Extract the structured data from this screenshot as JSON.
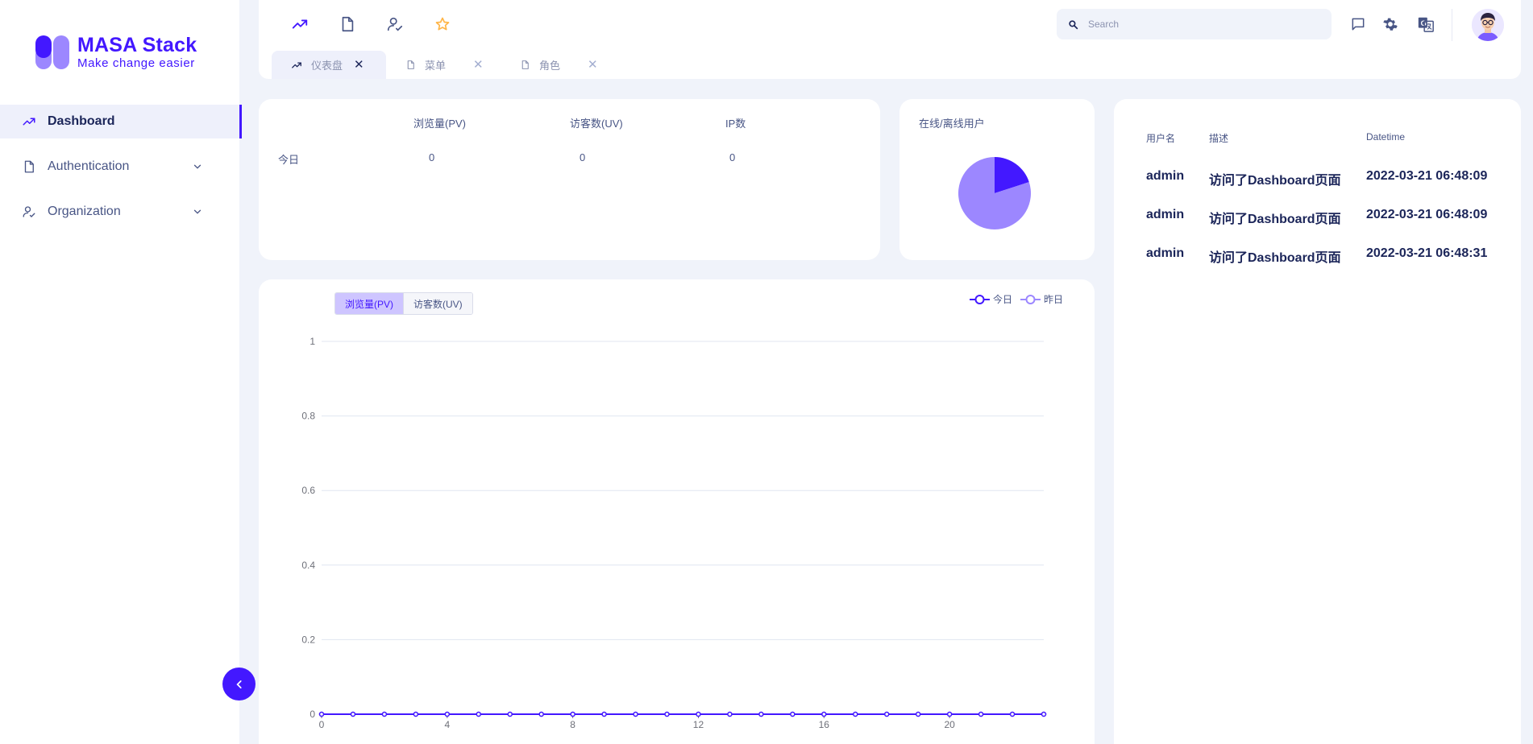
{
  "brand": {
    "title": "MASA Stack",
    "subtitle": "Make change easier",
    "accent": "#4318ff"
  },
  "sidebar": {
    "items": [
      {
        "label": "Dashboard",
        "icon": "trending-up-icon",
        "active": true
      },
      {
        "label": "Authentication",
        "icon": "file-icon",
        "expandable": true
      },
      {
        "label": "Organization",
        "icon": "user-check-icon",
        "expandable": true
      }
    ],
    "collapse_icon": "chevron-left-icon"
  },
  "header": {
    "quick_icons": [
      "trending-up-icon",
      "file-icon",
      "user-check-icon",
      "star-icon"
    ],
    "search": {
      "placeholder": "Search",
      "value": ""
    },
    "icons": [
      "message-icon",
      "gear-icon",
      "translate-icon"
    ],
    "tabs": [
      {
        "label": "仪表盘",
        "icon": "trending-up-icon",
        "active": true
      },
      {
        "label": "菜单",
        "icon": "file-icon",
        "active": false
      },
      {
        "label": "角色",
        "icon": "file-icon",
        "active": false
      }
    ]
  },
  "stats": {
    "columns": [
      "浏览量(PV)",
      "访客数(UV)",
      "IP数"
    ],
    "rows": [
      {
        "label": "今日",
        "values": [
          "0",
          "0",
          "0"
        ]
      }
    ]
  },
  "online_users": {
    "title": "在线/离线用户",
    "chart_data": {
      "type": "pie",
      "values": [
        0.2,
        0.8
      ],
      "colors": [
        "#4318ff",
        "#9c87ff"
      ]
    }
  },
  "access_log": {
    "headers": [
      "用户名",
      "描述",
      "Datetime"
    ],
    "rows": [
      [
        "admin",
        "访问了Dashboard页面",
        "2022-03-21 06:48:09"
      ],
      [
        "admin",
        "访问了Dashboard页面",
        "2022-03-21 06:48:09"
      ],
      [
        "admin",
        "访问了Dashboard页面",
        "2022-03-21 06:48:31"
      ]
    ]
  },
  "traffic_chart": {
    "toggle": [
      "浏览量(PV)",
      "访客数(UV)"
    ],
    "toggle_selected": "浏览量(PV)"
  },
  "chart_data": {
    "type": "line",
    "x": [
      0,
      1,
      2,
      3,
      4,
      5,
      6,
      7,
      8,
      9,
      10,
      11,
      12,
      13,
      14,
      15,
      16,
      17,
      18,
      19,
      20,
      21,
      22,
      23
    ],
    "x_ticks": [
      0,
      4,
      8,
      12,
      16,
      20
    ],
    "series": [
      {
        "name": "今日",
        "color": "#4318ff",
        "values": [
          0,
          0,
          0,
          0,
          0,
          0,
          0,
          0,
          0,
          0,
          0,
          0,
          0,
          0,
          0,
          0,
          0,
          0,
          0,
          0,
          0,
          0,
          0,
          0
        ]
      },
      {
        "name": "昨日",
        "color": "#9c87ff",
        "values": [
          0,
          0,
          0,
          0,
          0,
          0,
          0,
          0,
          0,
          0,
          0,
          0,
          0,
          0,
          0,
          0,
          0,
          0,
          0,
          0,
          0,
          0,
          0,
          0
        ]
      }
    ],
    "ylim": [
      0,
      1
    ],
    "y_ticks": [
      "0",
      "0.2",
      "0.4",
      "0.6",
      "0.8",
      "1"
    ],
    "grid": true,
    "legend_position": "top-right"
  }
}
